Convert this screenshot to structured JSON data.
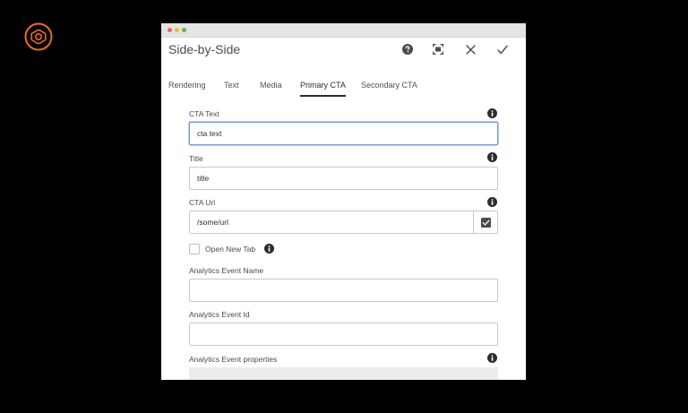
{
  "dialog": {
    "title": "Side-by-Side",
    "help_label": "Help",
    "fullscreen_label": "Toggle Fullscreen",
    "cancel_label": "Cancel",
    "done_label": "Done"
  },
  "tabs": [
    {
      "label": "Rendering",
      "active": false
    },
    {
      "label": "Text",
      "active": false
    },
    {
      "label": "Media",
      "active": false
    },
    {
      "label": "Primary CTA",
      "active": true
    },
    {
      "label": "Secondary CTA",
      "active": false
    }
  ],
  "fields": {
    "cta_text": {
      "label": "CTA Text",
      "value": "cta text"
    },
    "title": {
      "label": "Title",
      "value": "title"
    },
    "cta_url": {
      "label": "CTA Url",
      "value": "/some/url"
    },
    "open_new_tab": {
      "label": "Open New Tab",
      "checked": false
    },
    "analytics_event_name": {
      "label": "Analytics Event Name",
      "value": ""
    },
    "analytics_event_id": {
      "label": "Analytics Event Id",
      "value": ""
    },
    "analytics_event_properties": {
      "label": "Analytics Event properties"
    }
  },
  "colors": {
    "background": "#000000",
    "logo_accent": "#f06a1d",
    "focus_border": "#6f9bd8",
    "text_primary": "#2c2c2c",
    "text_secondary": "#4b4b4b"
  },
  "icons": {
    "logo": "aem-logo-icon",
    "help": "help-icon",
    "fullscreen": "fullscreen-icon",
    "close": "close-icon",
    "done": "checkmark-icon",
    "info": "info-icon",
    "picker": "checkbox-picker-icon"
  }
}
